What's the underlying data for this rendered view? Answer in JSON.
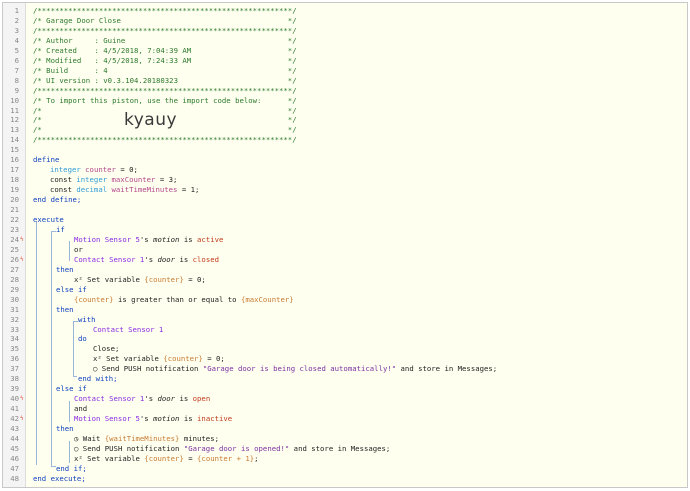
{
  "import_code": "kyauy",
  "lines": [
    {
      "n": "1",
      "t": "/**********************************************************/"
    },
    {
      "n": "2",
      "t": "/* Garage Door Close                                      */"
    },
    {
      "n": "3",
      "t": "/**********************************************************/"
    },
    {
      "n": "4",
      "t": "/* Author     : Guine                                     */"
    },
    {
      "n": "5",
      "t": "/* Created    : 4/5/2018, 7:04:39 AM                      */"
    },
    {
      "n": "6",
      "t": "/* Modified   : 4/5/2018, 7:24:33 AM                      */"
    },
    {
      "n": "7",
      "t": "/* Build      : 4                                         */"
    },
    {
      "n": "8",
      "t": "/* UI version : v0.3.104.20180323                         */"
    },
    {
      "n": "9",
      "t": "/**********************************************************/"
    },
    {
      "n": "10",
      "t": "/* To import this piston, use the import code below:      */"
    },
    {
      "n": "11",
      "t": "/*                                                        */"
    },
    {
      "n": "12",
      "t": "/*                                                        */"
    },
    {
      "n": "13",
      "t": "/*                                                        */"
    },
    {
      "n": "14",
      "t": "/**********************************************************/"
    },
    {
      "n": "15",
      "t": ""
    },
    {
      "n": "16",
      "t": "define"
    },
    {
      "n": "17",
      "t": "integer counter = 0;"
    },
    {
      "n": "18",
      "t": "const integer maxCounter = 3;"
    },
    {
      "n": "19",
      "t": "const decimal waitTimeMinutes = 1;"
    },
    {
      "n": "20",
      "t": "end define;"
    },
    {
      "n": "21",
      "t": ""
    },
    {
      "n": "22",
      "t": "execute"
    },
    {
      "n": "23",
      "t": "if"
    },
    {
      "n": "24",
      "t": "Motion Sensor 5's motion is active"
    },
    {
      "n": "25",
      "t": "or"
    },
    {
      "n": "26",
      "t": "Contact Sensor 1's door is closed"
    },
    {
      "n": "27",
      "t": "then"
    },
    {
      "n": "28",
      "t": "x² Set variable {counter} = 0;"
    },
    {
      "n": "29",
      "t": "else if"
    },
    {
      "n": "30",
      "t": "{counter} is greater than or equal to {maxCounter}"
    },
    {
      "n": "31",
      "t": "then"
    },
    {
      "n": "32",
      "t": "with"
    },
    {
      "n": "33",
      "t": "Contact Sensor 1"
    },
    {
      "n": "34",
      "t": "do"
    },
    {
      "n": "35",
      "t": "Close;"
    },
    {
      "n": "36",
      "t": "x² Set variable {counter} = 0;"
    },
    {
      "n": "37",
      "t": "Send PUSH notification \"Garage door is being closed automatically!\" and store in Messages;"
    },
    {
      "n": "38",
      "t": "end with;"
    },
    {
      "n": "39",
      "t": "else if"
    },
    {
      "n": "40",
      "t": "Contact Sensor 1's door is open"
    },
    {
      "n": "41",
      "t": "and"
    },
    {
      "n": "42",
      "t": "Motion Sensor 5's motion is inactive"
    },
    {
      "n": "43",
      "t": "then"
    },
    {
      "n": "44",
      "t": "Wait {waitTimeMinutes} minutes;"
    },
    {
      "n": "45",
      "t": "Send PUSH notification \"Garage door is opened!\" and store in Messages;"
    },
    {
      "n": "46",
      "t": "x² Set variable {counter} = {counter + 1};"
    },
    {
      "n": "47",
      "t": "end if;"
    },
    {
      "n": "48",
      "t": "end execute;"
    }
  ],
  "colors": {
    "comment": "#2c7a2c",
    "keyword": "#0b3fbd",
    "type": "#2f9bd6",
    "variable": "#b4478a",
    "device": "#8a2be2",
    "value": "#c13a1a",
    "string": "#7a2fa0",
    "expression": "#c87a30",
    "background": "#fffff0"
  }
}
